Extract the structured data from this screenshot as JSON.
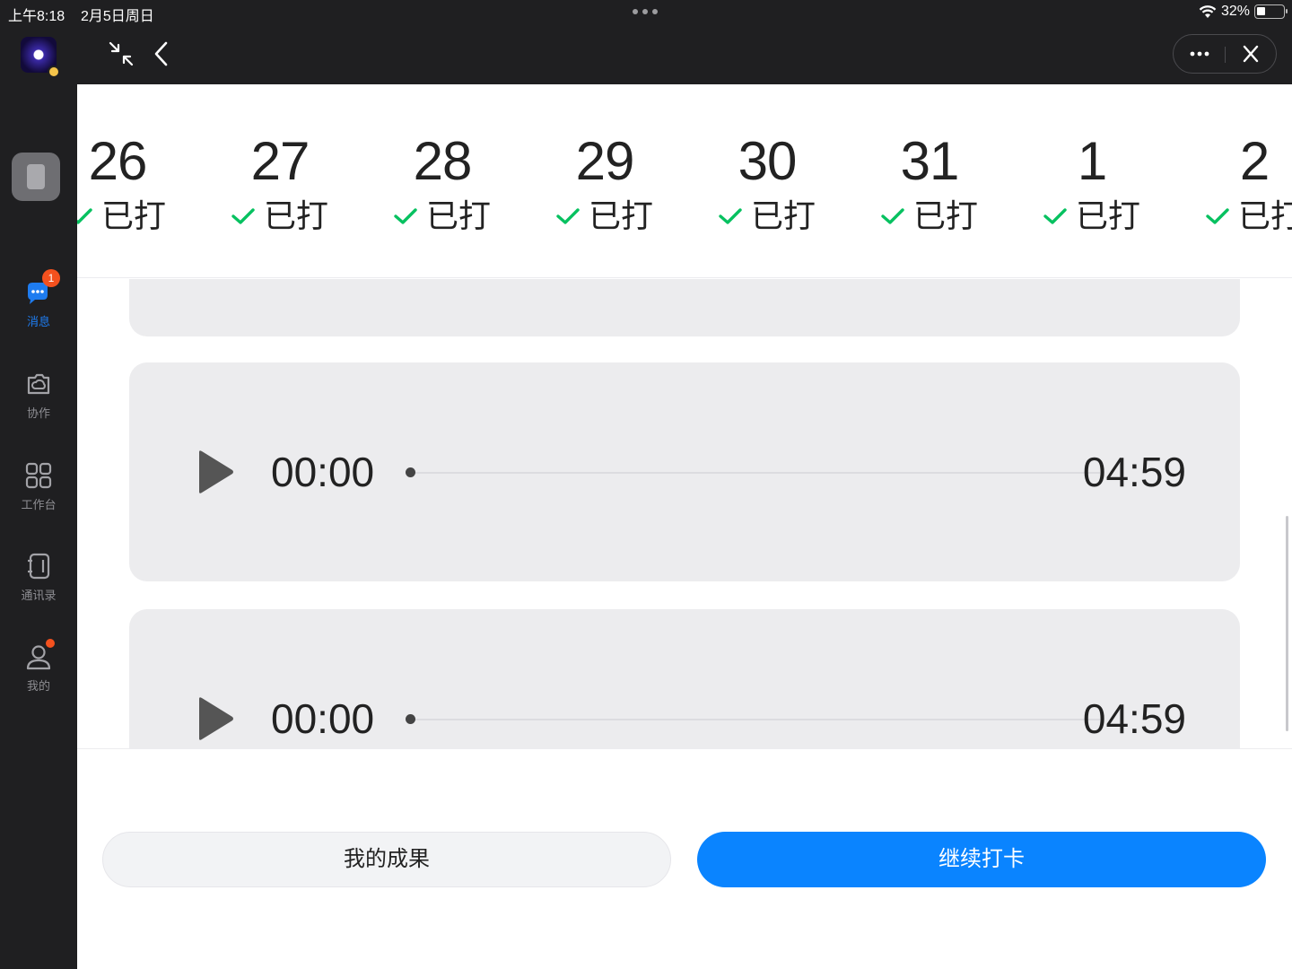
{
  "status_bar": {
    "time": "上午8:18",
    "date": "2月5日周日",
    "battery": "32%"
  },
  "sidebar": {
    "items": [
      {
        "label": "消息",
        "icon": "chat-bubble-icon",
        "badge": "1",
        "active": true
      },
      {
        "label": "协作",
        "icon": "cloud-folder-icon"
      },
      {
        "label": "工作台",
        "icon": "grid-apps-icon"
      },
      {
        "label": "通讯录",
        "icon": "contacts-book-icon"
      },
      {
        "label": "我的",
        "icon": "person-icon",
        "dot": true
      }
    ]
  },
  "calendar": {
    "days": [
      {
        "day": "26",
        "status": "已打"
      },
      {
        "day": "27",
        "status": "已打"
      },
      {
        "day": "28",
        "status": "已打"
      },
      {
        "day": "29",
        "status": "已打"
      },
      {
        "day": "30",
        "status": "已打"
      },
      {
        "day": "31",
        "status": "已打"
      },
      {
        "day": "1",
        "status": "已打"
      },
      {
        "day": "2",
        "status": "已打"
      }
    ],
    "check_color": "#07c160"
  },
  "audio": [
    {
      "current": "00:00",
      "total": "04:59",
      "progress": 0
    },
    {
      "current": "00:00",
      "total": "04:59",
      "progress": 0
    }
  ],
  "actions": {
    "secondary": "我的成果",
    "primary": "继续打卡",
    "primary_color": "#0a84ff"
  }
}
